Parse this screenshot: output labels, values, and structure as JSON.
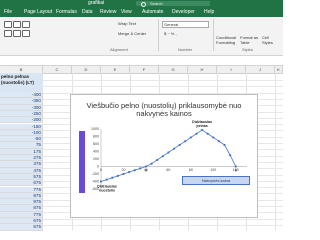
{
  "window": {
    "title": "grafikai"
  },
  "search": {
    "placeholder": "Search"
  },
  "tabs": [
    "File",
    "Page Layout",
    "Formulas",
    "Data",
    "Review",
    "View",
    "Automate",
    "Developer",
    "Help"
  ],
  "ribbon": {
    "wrap_text": "Wrap Text",
    "merge_center": "Merge & Center",
    "number_format": "General",
    "conditional_formatting": "Conditional Formatting",
    "format_as_table": "Format as Table",
    "cell_styles": "Cell Styles",
    "group_alignment": "Alignment",
    "group_number": "Number",
    "group_styles": "Styles"
  },
  "columns": [
    "B",
    "C",
    "D",
    "E",
    "F",
    "G",
    "H",
    "I",
    "J",
    "K"
  ],
  "column_b": {
    "header": "pelno pelnas (nuostolis) (LT)",
    "values": [
      "-400",
      "-350",
      "-300",
      "-250",
      "-200",
      "-150",
      "-100",
      "-50",
      "75",
      "175",
      "275",
      "375",
      "475",
      "575",
      "675",
      "775",
      "875",
      "975",
      "875",
      "775",
      "675",
      "575"
    ]
  },
  "chart_data": {
    "type": "scatter",
    "title": "Viešbučio pelno (nuostolių) priklausomybė nuo nakvynės kainos",
    "xlabel": "Nakvynės kaina",
    "ylabel": "",
    "xlim": [
      0,
      130
    ],
    "ylim": [
      -600,
      1000
    ],
    "x_ticks": [
      "0",
      "20",
      "40",
      "60",
      "80",
      "100",
      "120"
    ],
    "y_ticks": [
      "-600",
      "-400",
      "-200",
      "0",
      "200",
      "400",
      "600",
      "800",
      "1000"
    ],
    "series": [
      {
        "values": [
          [
            0,
            -400
          ],
          [
            5,
            -350
          ],
          [
            10,
            -300
          ],
          [
            15,
            -250
          ],
          [
            20,
            -200
          ],
          [
            25,
            -150
          ],
          [
            30,
            -100
          ],
          [
            35,
            -50
          ],
          [
            40,
            0
          ],
          [
            45,
            75
          ],
          [
            50,
            175
          ],
          [
            55,
            275
          ],
          [
            60,
            375
          ],
          [
            65,
            475
          ],
          [
            70,
            575
          ],
          [
            75,
            675
          ],
          [
            80,
            775
          ],
          [
            85,
            875
          ],
          [
            90,
            975
          ],
          [
            95,
            875
          ],
          [
            100,
            775
          ],
          [
            105,
            675
          ],
          [
            110,
            575
          ],
          [
            115,
            300
          ],
          [
            120,
            0
          ]
        ]
      }
    ],
    "annotations": [
      {
        "text": "Didžiausias pelnas",
        "x": 90,
        "y": 975
      },
      {
        "text": "Didžiausias nuostolis",
        "x": 0,
        "y": -400
      },
      {
        "text": "0",
        "x": 40,
        "y": 0
      },
      {
        "text": "0",
        "x": 120,
        "y": 0
      }
    ]
  }
}
